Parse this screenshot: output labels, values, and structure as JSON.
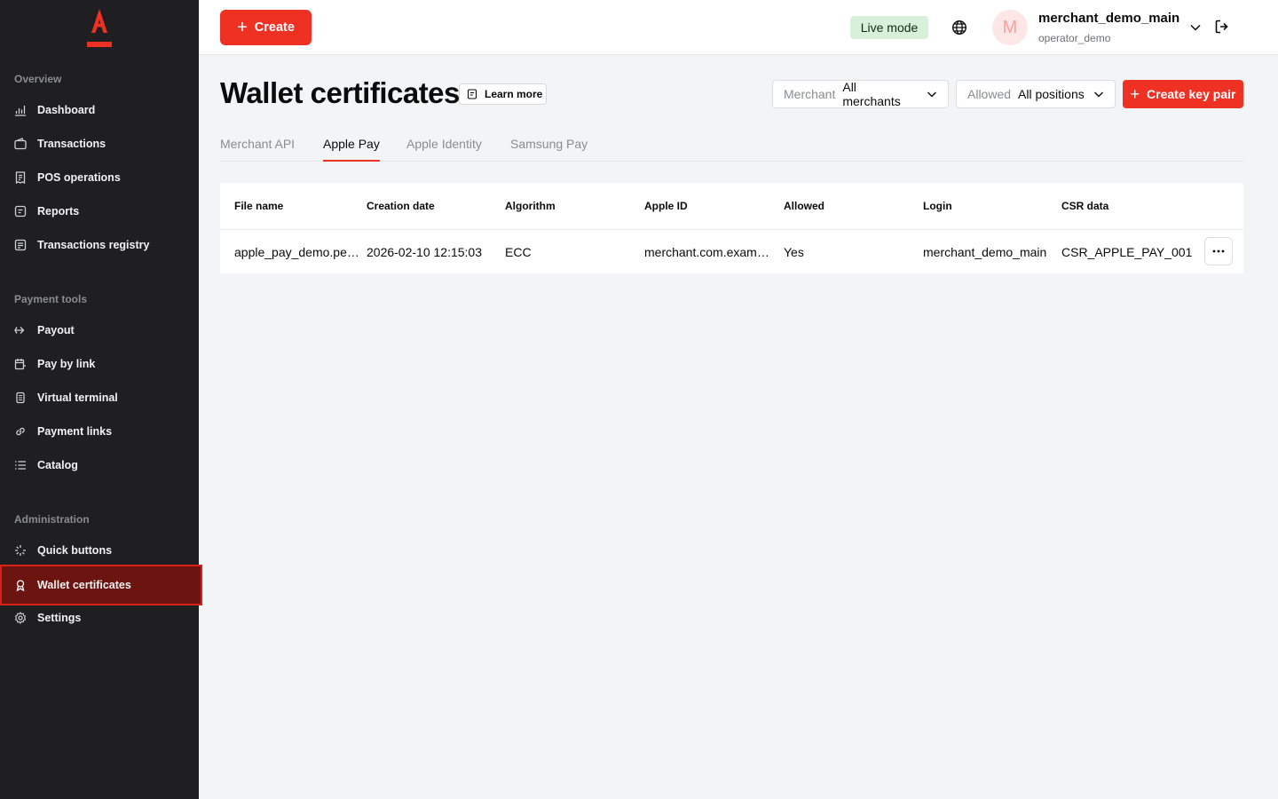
{
  "sidebar": {
    "sections": [
      {
        "title": "Overview"
      },
      {
        "title": "Payment tools"
      },
      {
        "title": "Administration"
      }
    ],
    "items": [
      {
        "label": "Dashboard",
        "icon": "bar-chart-icon"
      },
      {
        "label": "Transactions",
        "icon": "wallet-icon"
      },
      {
        "label": "POS operations",
        "icon": "receipt-icon"
      },
      {
        "label": "Reports",
        "icon": "report-icon"
      },
      {
        "label": "Transactions registry",
        "icon": "registry-icon"
      },
      {
        "label": "Payout",
        "icon": "payout-icon"
      },
      {
        "label": "Pay by link",
        "icon": "calendar-link-icon"
      },
      {
        "label": "Virtual terminal",
        "icon": "terminal-icon"
      },
      {
        "label": "Payment links",
        "icon": "link-icon"
      },
      {
        "label": "Catalog",
        "icon": "list-icon"
      },
      {
        "label": "Quick buttons",
        "icon": "sparkle-icon"
      },
      {
        "label": "Wallet certificates",
        "icon": "certificate-icon",
        "active": true
      },
      {
        "label": "Settings",
        "icon": "gear-icon"
      }
    ]
  },
  "header": {
    "create_label": "Create",
    "mode_label": "Live mode",
    "avatar_letter": "M",
    "user_name": "merchant_demo_main",
    "user_login": "operator_demo"
  },
  "main": {
    "title": "Wallet certificates",
    "learn_more": "Learn more",
    "merchant_filter": {
      "label": "Merchant",
      "value": "All merchants"
    },
    "allowed_filter": {
      "label": "Allowed",
      "value": "All positions"
    },
    "create_key_pair": "Create key pair",
    "tabs": [
      "Merchant API",
      "Apple Pay",
      "Apple Identity",
      "Samsung Pay"
    ],
    "active_tab": "Apple Pay"
  },
  "table": {
    "columns": [
      "File name",
      "Creation date",
      "Algorithm",
      "Apple ID",
      "Allowed",
      "Login",
      "CSR data"
    ],
    "rows": [
      [
        "apple_pay_demo.pe…",
        "2026-02-10 12:15:03",
        "ECC",
        "merchant.com.exam…",
        "Yes",
        "merchant_demo_main",
        "CSR_APPLE_PAY_001"
      ]
    ]
  },
  "colors": {
    "accent": "#ef3124",
    "sidebar_bg": "#1f1f22",
    "active_item_bg": "#6b1410",
    "live_badge_bg": "#d8efd9"
  }
}
